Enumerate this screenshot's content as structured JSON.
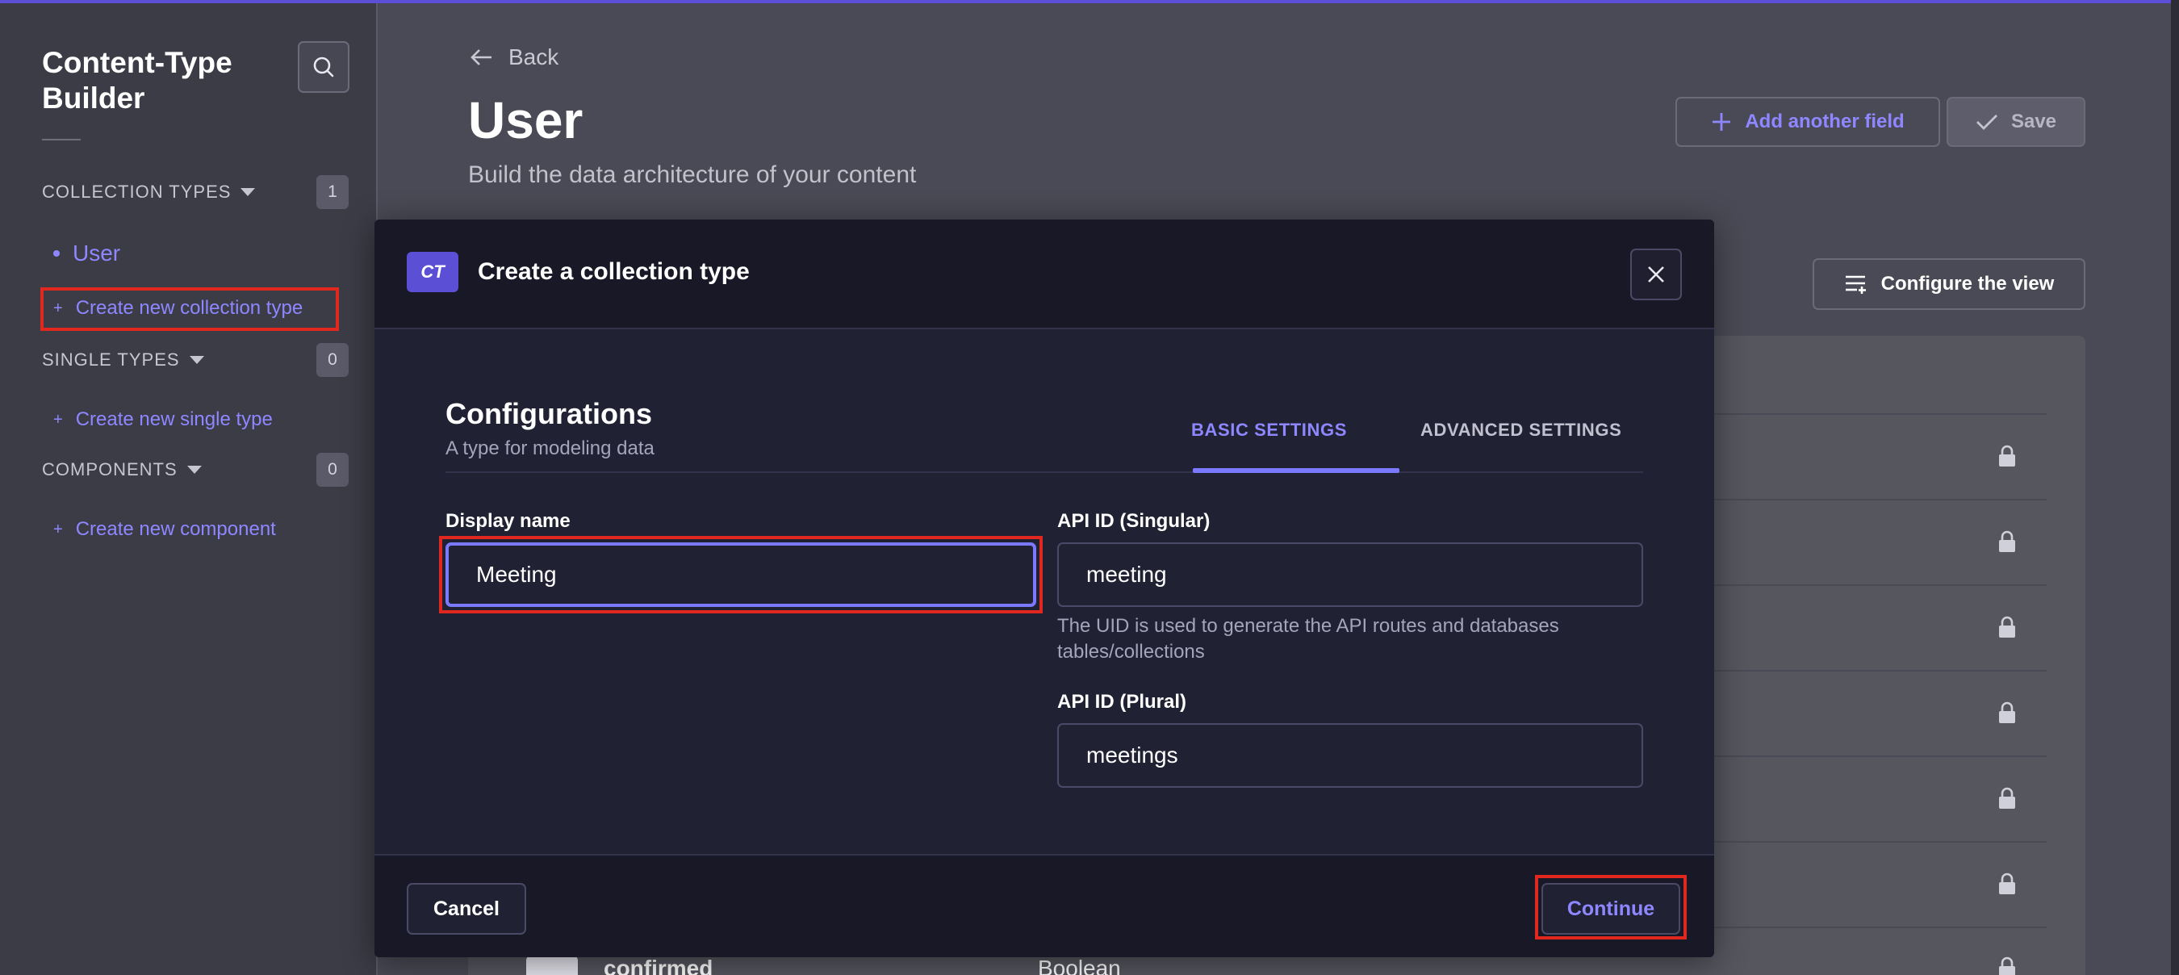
{
  "sidebar": {
    "title": "Content-Type Builder",
    "collection_types": {
      "label": "COLLECTION TYPES",
      "count": "1",
      "items": [
        {
          "label": "User"
        }
      ],
      "create_label": "Create new collection type"
    },
    "single_types": {
      "label": "SINGLE TYPES",
      "count": "0",
      "create_label": "Create new single type"
    },
    "components": {
      "label": "COMPONENTS",
      "count": "0",
      "create_label": "Create new component"
    }
  },
  "main": {
    "back_label": "Back",
    "title": "User",
    "subtitle": "Build the data architecture of your content",
    "add_field_label": "Add another field",
    "save_label": "Save",
    "configure_view_label": "Configure the view",
    "visible_row": {
      "name": "confirmed",
      "type": "Boolean"
    }
  },
  "modal": {
    "badge": "CT",
    "title": "Create a collection type",
    "section_title": "Configurations",
    "section_subtitle": "A type for modeling data",
    "tabs": [
      {
        "label": "BASIC SETTINGS",
        "active": true
      },
      {
        "label": "ADVANCED SETTINGS",
        "active": false
      }
    ],
    "display_name": {
      "label": "Display name",
      "value": "Meeting"
    },
    "api_singular": {
      "label": "API ID (Singular)",
      "value": "meeting",
      "hint": "The UID is used to generate the API routes and databases tables/collections"
    },
    "api_plural": {
      "label": "API ID (Plural)",
      "value": "meetings"
    },
    "cancel_label": "Cancel",
    "continue_label": "Continue"
  },
  "colors": {
    "accent": "#7b79ff",
    "primary": "#5b4fd6",
    "highlight": "#e0281e",
    "modal_bg": "#212134"
  },
  "icons": [
    "search-icon",
    "arrow-left-icon",
    "plus-icon",
    "check-icon",
    "list-settings-icon",
    "close-icon",
    "lock-icon",
    "caret-down-icon"
  ]
}
